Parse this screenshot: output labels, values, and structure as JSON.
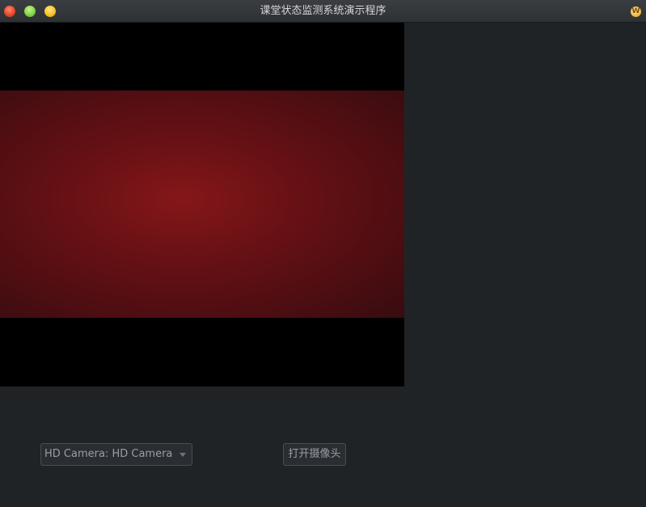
{
  "window": {
    "title": "课堂状态监测系统演示程序",
    "app_badge": "W"
  },
  "controls": {
    "camera_select_value": "HD Camera: HD Camera",
    "open_camera_label": "打开摄像头"
  },
  "icons": {
    "close": "close-icon",
    "minimize": "minimize-icon",
    "maximize": "maximize-icon",
    "app": "app-icon",
    "dropdown": "chevron-down-icon"
  },
  "colors": {
    "background": "#1f2326",
    "video_background": "#000000",
    "video_tint": "#7a1418"
  }
}
